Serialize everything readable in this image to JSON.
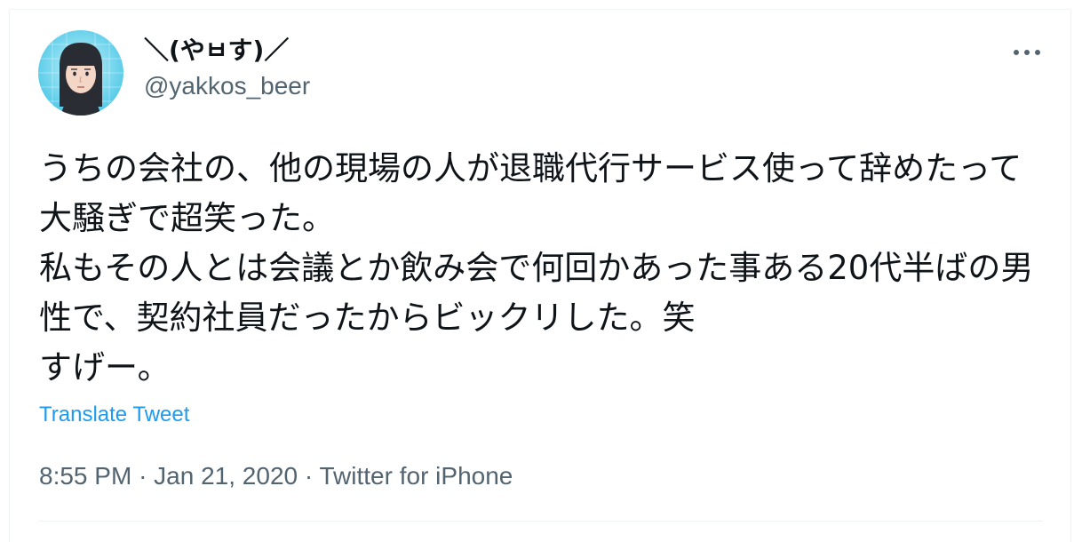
{
  "tweet": {
    "author": {
      "display_name": "＼(やㅂす)／",
      "handle": "@yakkos_beer",
      "avatar_icon": "mii-avatar-icon"
    },
    "more_icon": "more-horizontal-icon",
    "text": "うちの会社の、他の現場の人が退職代行サービス使って辞めたって大騒ぎで超笑った。\n私もその人とは会議とか飲み会で何回かあった事ある20代半ばの男性で、契約社員だったからビックリした。笑\nすげー。",
    "translate_label": "Translate Tweet",
    "time": "8:55 PM",
    "separator": "·",
    "date": "Jan 21, 2020",
    "source": "Twitter for iPhone"
  },
  "colors": {
    "text": "#0f1419",
    "secondary": "#536471",
    "link": "#1d9bf0",
    "border": "#eff3f4"
  }
}
